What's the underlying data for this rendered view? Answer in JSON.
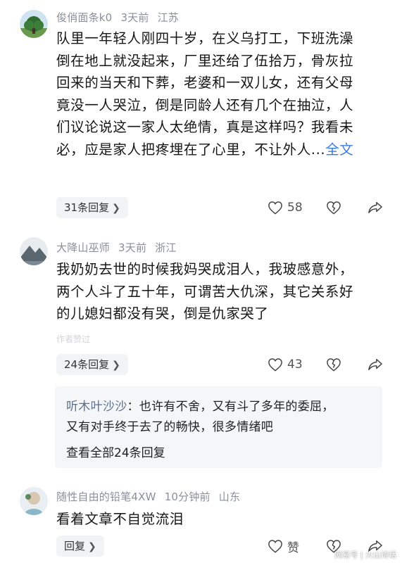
{
  "comments": [
    {
      "username": "俊俏面条k0",
      "time": "3天前",
      "location": "江苏",
      "lines": [
        "队里一年轻人刚四十岁，在义乌打工，下班洗澡",
        "倒在地上就没起来，厂里还给了伍拾万，骨灰拉",
        "回来的当天和下葬，老婆和一双儿女，还有父母",
        "竟没一人哭泣，倒是同龄人还有几个在抽泣，人",
        "们议论说这一家人太绝情，真是这样吗？我看未",
        "必，应是家人把疼埋在了心里，不让外人..."
      ],
      "full_text_label": "全文",
      "replies_label": "31条回复",
      "like_count": "58"
    },
    {
      "username": "大降山巫师",
      "time": "3天前",
      "location": "浙江",
      "lines": [
        "我奶奶去世的时候我妈哭成泪人，我玻感意外，",
        "两个人斗了五十年，可谓苦大仇深，其它关系好",
        "的儿媳妇都没有哭，倒是仇家哭了"
      ],
      "faded_tag": "作者赞过",
      "replies_label": "24条回复",
      "like_count": "43",
      "sub_reply": {
        "author": "听木叶沙沙",
        "line1": "：也许有不舍，又有斗了多年的委屈，",
        "line2": "又有对手终于去了的畅快，很多情绪吧",
        "view_all": "查看全部24条回复"
      }
    },
    {
      "username": "随性自由的铅笔4XW",
      "time": "10分钟前",
      "location": "山东",
      "lines": [
        "看着文章不自觉流泪"
      ],
      "reply_label": "回复",
      "like_label": "赞"
    }
  ],
  "icons": {
    "like": "heart-outline-icon",
    "dislike": "broken-heart-icon",
    "share": "share-arrow-icon",
    "chevron": "chevron-right-icon"
  },
  "watermark": "网易号 | 火山诗话"
}
